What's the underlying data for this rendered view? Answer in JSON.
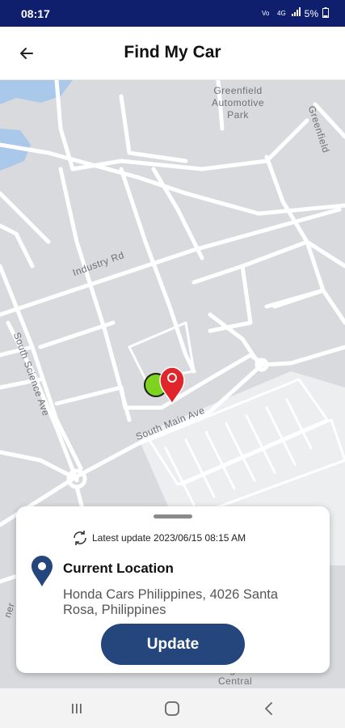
{
  "status_bar": {
    "time": "08:17",
    "battery": "5%",
    "icons": [
      "volte-icon",
      "signal-4g-icon",
      "signal-bars-icon",
      "battery-icon"
    ]
  },
  "app_bar": {
    "title": "Find My Car",
    "back_icon": "arrow-left-icon"
  },
  "map": {
    "labels": {
      "park": "Greenfield\nAutomotive\nPark",
      "greenfield": "Greenfield",
      "industry_rd": "Industry Rd",
      "south_science": "South Science Ave",
      "south_main": "South Main Ave",
      "laguna": "Laguna\nCentral",
      "partial_left": "ner"
    },
    "car_marker_color": "#7ed321",
    "pin_color": "#e0252b"
  },
  "sheet": {
    "latest_update": "Latest update 2023/06/15 08:15 AM",
    "location_title": "Current Location",
    "address": "Honda Cars Philippines, 4026 Santa Rosa, Philippines",
    "update_label": "Update"
  },
  "colors": {
    "status_bar": "#0f1f6e",
    "button": "#24467d",
    "location_pin": "#24467d"
  },
  "nav_bar": {
    "icons": [
      "recents-icon",
      "home-icon",
      "back-icon"
    ]
  }
}
